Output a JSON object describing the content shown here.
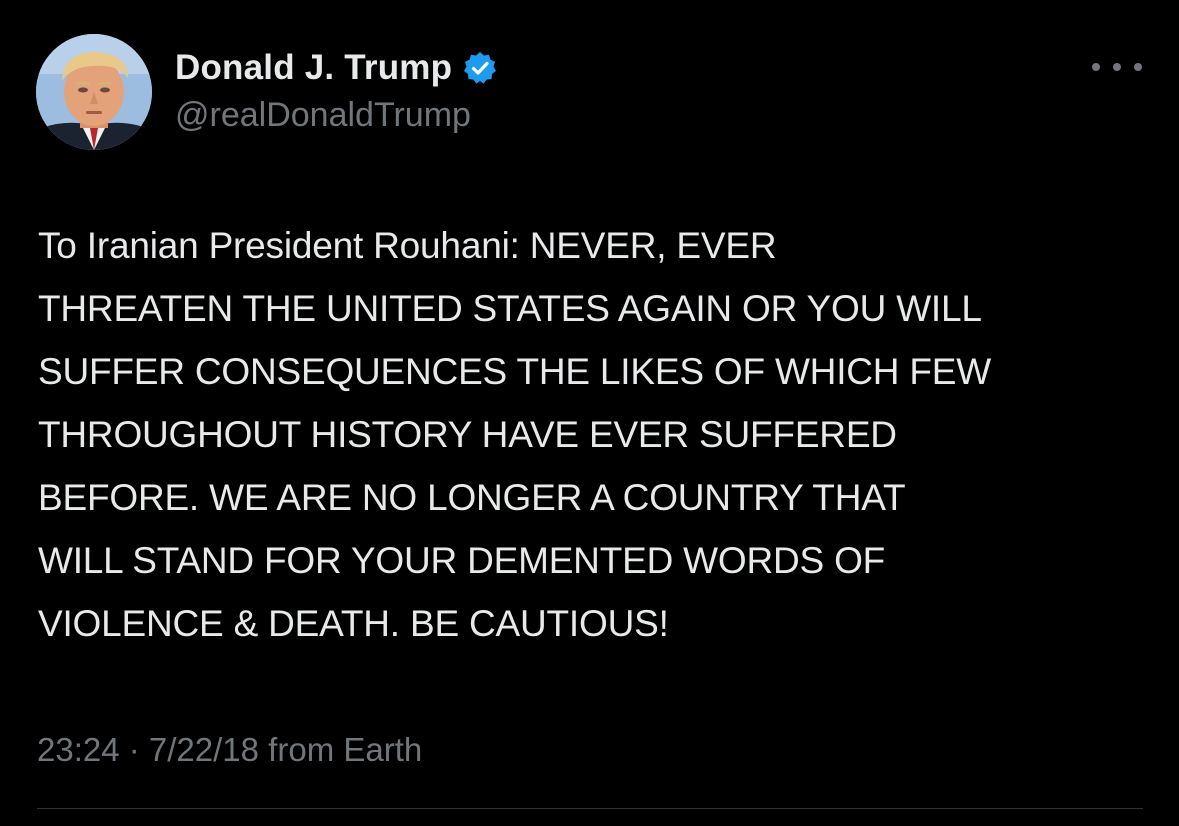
{
  "author": {
    "display_name": "Donald J. Trump",
    "handle": "@realDonaldTrump",
    "verified": true,
    "verified_badge_color": "#1d9bf0"
  },
  "tweet": {
    "text": "To Iranian President Rouhani: NEVER, EVER\nTHREATEN THE UNITED STATES AGAIN OR YOU WILL\nSUFFER CONSEQUENCES THE LIKES OF WHICH FEW\nTHROUGHOUT HISTORY HAVE EVER SUFFERED\nBEFORE. WE ARE NO LONGER A COUNTRY THAT\nWILL STAND FOR YOUR DEMENTED WORDS OF\nVIOLENCE & DEATH. BE CAUTIOUS!",
    "timestamp": "23:24 · 7/22/18 from Earth"
  },
  "icons": {
    "more": "more-options-icon",
    "verified": "verified-badge-icon"
  },
  "colors": {
    "background": "#000000",
    "primary_text": "#e7e9ea",
    "secondary_text": "#71767b",
    "divider": "#2f3336"
  }
}
